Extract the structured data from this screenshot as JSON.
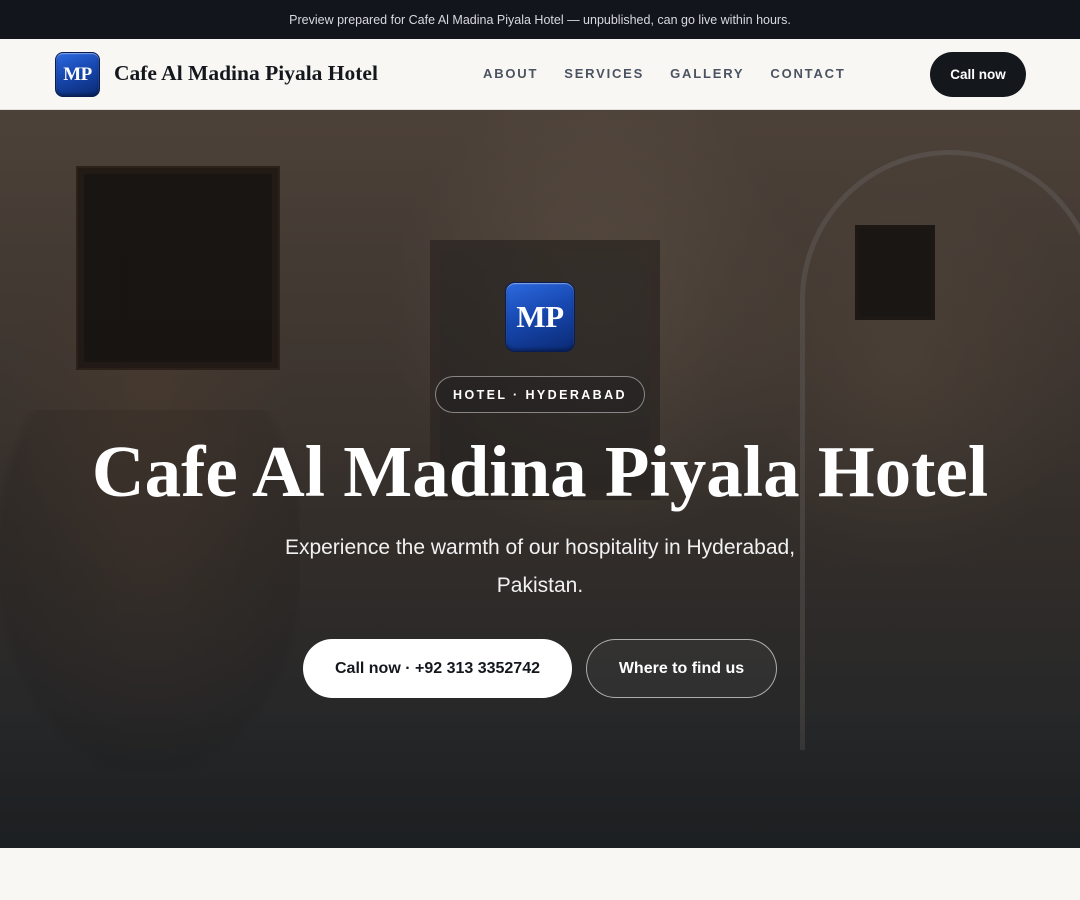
{
  "preview_banner": "Preview prepared for Cafe Al Madina Piyala Hotel — unpublished, can go live within hours.",
  "header": {
    "logo_text": "MP",
    "brand_name": "Cafe Al Madina Piyala Hotel",
    "nav": [
      "ABOUT",
      "SERVICES",
      "GALLERY",
      "CONTACT"
    ],
    "cta_label": "Call now"
  },
  "hero": {
    "logo_text": "MP",
    "tag": "HOTEL · HYDERABAD",
    "title": "Cafe Al Madina Piyala Hotel",
    "subtitle": "Experience the warmth of our hospitality in Hyderabad, Pakistan.",
    "primary_button": "Call now · +92 313 3352742",
    "secondary_button": "Where to find us"
  },
  "colors": {
    "banner_bg": "#12151b",
    "accent_dark": "#14171c",
    "logo_blue": "#1748b0",
    "page_bg": "#f8f7f4"
  },
  "icons": {
    "logo": "mp-logo-badge"
  }
}
